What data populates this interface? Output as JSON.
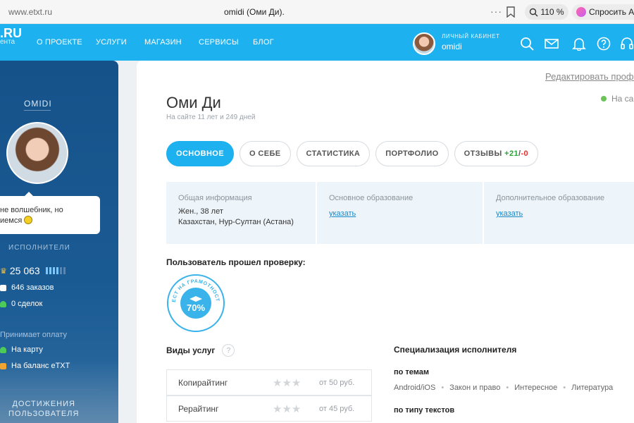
{
  "browser": {
    "url": "www.etxt.ru",
    "title": "omidi (Оми Ди).",
    "zoom": "110 %",
    "ask_button": "Спросить Ал"
  },
  "site": {
    "logo": ".RU",
    "logo_sub": "ента",
    "nav": [
      "О ПРОЕКТЕ",
      "УСЛУГИ",
      "МАГАЗИН",
      "СЕРВИСЫ",
      "БЛОГ"
    ],
    "cabinet_label": "ЛИЧНЫЙ КАБИНЕТ",
    "cabinet_user": "omidi",
    "icons": [
      "search-icon",
      "mail-icon",
      "bell-icon",
      "help-icon",
      "headset-icon"
    ],
    "accent": "#1eb1ef"
  },
  "sidebar": {
    "username": "OMIDI",
    "status_text": "не волшебник, но",
    "status_text2": "иемся",
    "section_performers": "ИСПОЛНИТЕЛИ",
    "rating": "25 063",
    "orders": "646 заказов",
    "deals": "0 сделок",
    "payment_title": "Принимает оплату",
    "pay_card": "На карту",
    "pay_balance": "На баланс eTXT",
    "achievements_1": "ДОСТИЖЕНИЯ",
    "achievements_2": "ПОЛЬЗОВАТЕЛЯ"
  },
  "profile": {
    "edit_link": "Редактировать профи",
    "online": "На сай",
    "name": "Оми Ди",
    "since": "На сайте 11 лет и 249 дней",
    "tabs": {
      "main": "ОСНОВНОЕ",
      "about": "О СЕБЕ",
      "stats": "СТАТИСТИКА",
      "portfolio": "ПОРТФОЛИО",
      "reviews": "ОТЗЫВЫ",
      "reviews_pos": "+21",
      "reviews_slash": "/",
      "reviews_neg": "-0"
    },
    "general_info": {
      "title": "Общая информация",
      "line1": "Жен., 38 лет",
      "line2": "Казахстан, Нур-Султан (Астана)"
    },
    "education": {
      "title": "Основное образование",
      "link": "указать"
    },
    "extra_education": {
      "title": "Дополнительное образование",
      "link": "указать"
    },
    "verified_title": "Пользователь прошел проверку:",
    "badge": {
      "ring_text": "ТЕСТ НА ГРАМОТНОСТЬ",
      "percent": "70%"
    },
    "services_title": "Виды услуг",
    "help_mark": "?",
    "services": [
      {
        "name": "Копирайтинг",
        "price": "от 50 руб.",
        "stars": 3
      },
      {
        "name": "Рерайтинг",
        "price": "от 45 руб.",
        "stars": 3
      }
    ],
    "specialization_title": "Специализация исполнителя",
    "by_topics": "по темам",
    "topics": [
      "Android/iOS",
      "Закон и право",
      "Интересное",
      "Литература"
    ],
    "by_types": "по типу текстов"
  }
}
